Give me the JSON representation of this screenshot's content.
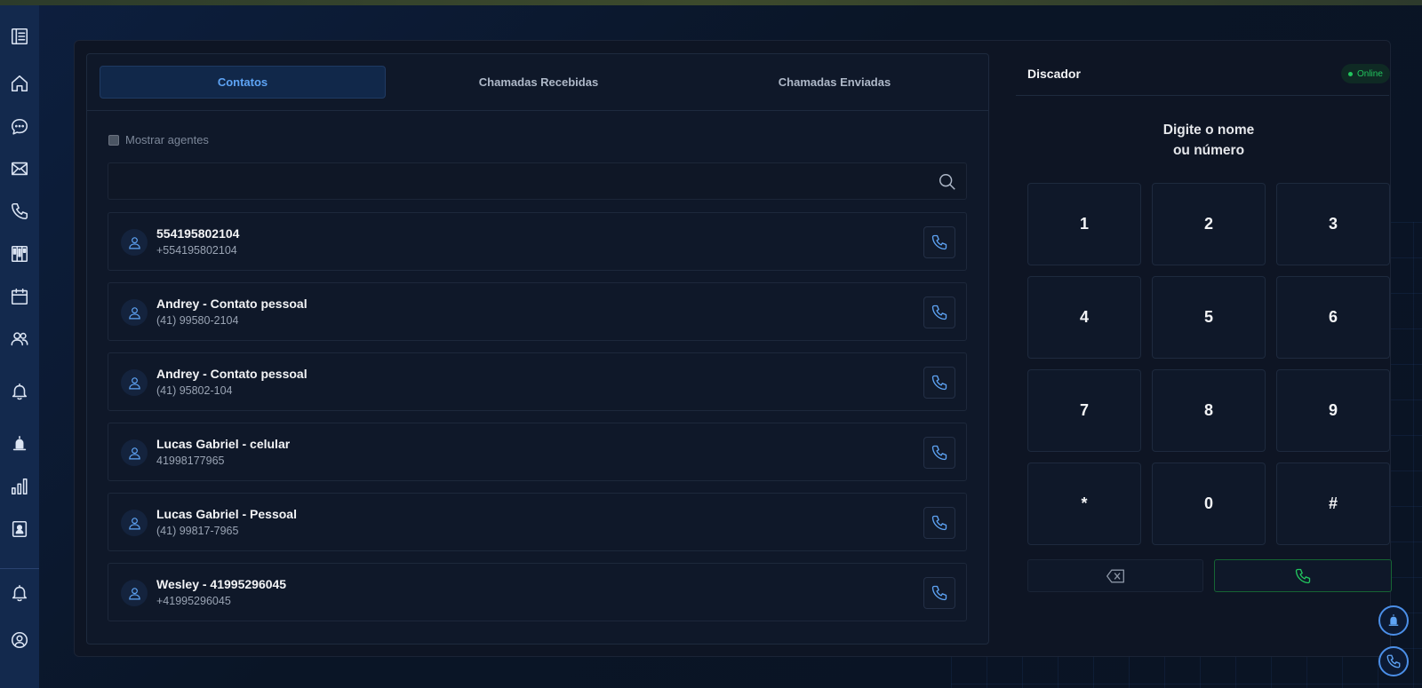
{
  "tabs": [
    {
      "label": "Contatos",
      "active": true
    },
    {
      "label": "Chamadas Recebidas",
      "active": false
    },
    {
      "label": "Chamadas Enviadas",
      "active": false
    }
  ],
  "filter": {
    "show_agents_label": "Mostrar agentes",
    "checked": false
  },
  "search": {
    "placeholder": "",
    "value": ""
  },
  "contacts": [
    {
      "name": "554195802104",
      "number": "+554195802104"
    },
    {
      "name": "Andrey - Contato pessoal",
      "number": "(41) 99580-2104"
    },
    {
      "name": "Andrey - Contato pessoal",
      "number": "(41) 95802-104"
    },
    {
      "name": "Lucas Gabriel - celular",
      "number": "41998177965"
    },
    {
      "name": "Lucas Gabriel - Pessoal",
      "number": "(41) 99817-7965"
    },
    {
      "name": "Wesley - 41995296045",
      "number": "+41995296045"
    }
  ],
  "dialer": {
    "title": "Discador",
    "status": "Online",
    "prompt_line1": "Digite o nome",
    "prompt_line2": "ou número",
    "keys": [
      "1",
      "2",
      "3",
      "4",
      "5",
      "6",
      "7",
      "8",
      "9",
      "*",
      "0",
      "#"
    ]
  },
  "sidebar": {
    "icons": [
      "list-icon",
      "home-icon",
      "chat-icon",
      "mail-icon",
      "phone-icon",
      "kanban-icon",
      "calendar-icon",
      "users-icon",
      "bell-icon",
      "alert-icon",
      "bar-chart-icon",
      "contact-card-icon",
      "bell-icon",
      "user-circle-icon"
    ]
  },
  "colors": {
    "accent": "#5ea4f5",
    "online": "#22c55e",
    "sidebar": "#13294d",
    "panel": "#0f1829"
  }
}
